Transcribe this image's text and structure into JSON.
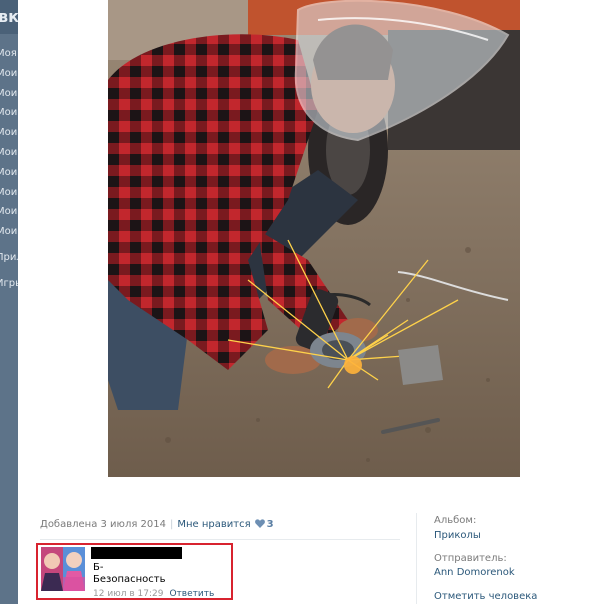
{
  "sidebar": {
    "logo": "вк",
    "items": [
      {
        "label": "Моя Страница"
      },
      {
        "label": "Мои Музыка"
      },
      {
        "label": "Мои Фотографии"
      },
      {
        "label": "Мои Видеозаписи"
      },
      {
        "label": "Мои Аудиозаписи"
      },
      {
        "label": "Мои Сообщения"
      },
      {
        "label": "Мои Группы"
      },
      {
        "label": "Мои Новости"
      },
      {
        "label": "Мои Ответы"
      },
      {
        "label": "Мои Настройки"
      },
      {
        "label": "Приложения"
      },
      {
        "label": "Игры"
      }
    ]
  },
  "photo_info": {
    "added_text": "Добавлена 3 июля 2014",
    "like_label": "Мне нравится",
    "like_count": "3",
    "heart_color": "#6d8fb3"
  },
  "comment": {
    "line1": "Б-",
    "line2": "Безопасность",
    "time": "12 июл в 17:29",
    "reply_label": "Ответить"
  },
  "side": {
    "album_label": "Альбом:",
    "album_value": "Приколы",
    "sender_label": "Отправитель:",
    "sender_value": "Ann Domorenok",
    "mark_label": "Отметить человека"
  },
  "colors": {
    "link": "#2b587a",
    "highlight_border": "#d8232f",
    "sidebar_bg": "#5d7389"
  }
}
